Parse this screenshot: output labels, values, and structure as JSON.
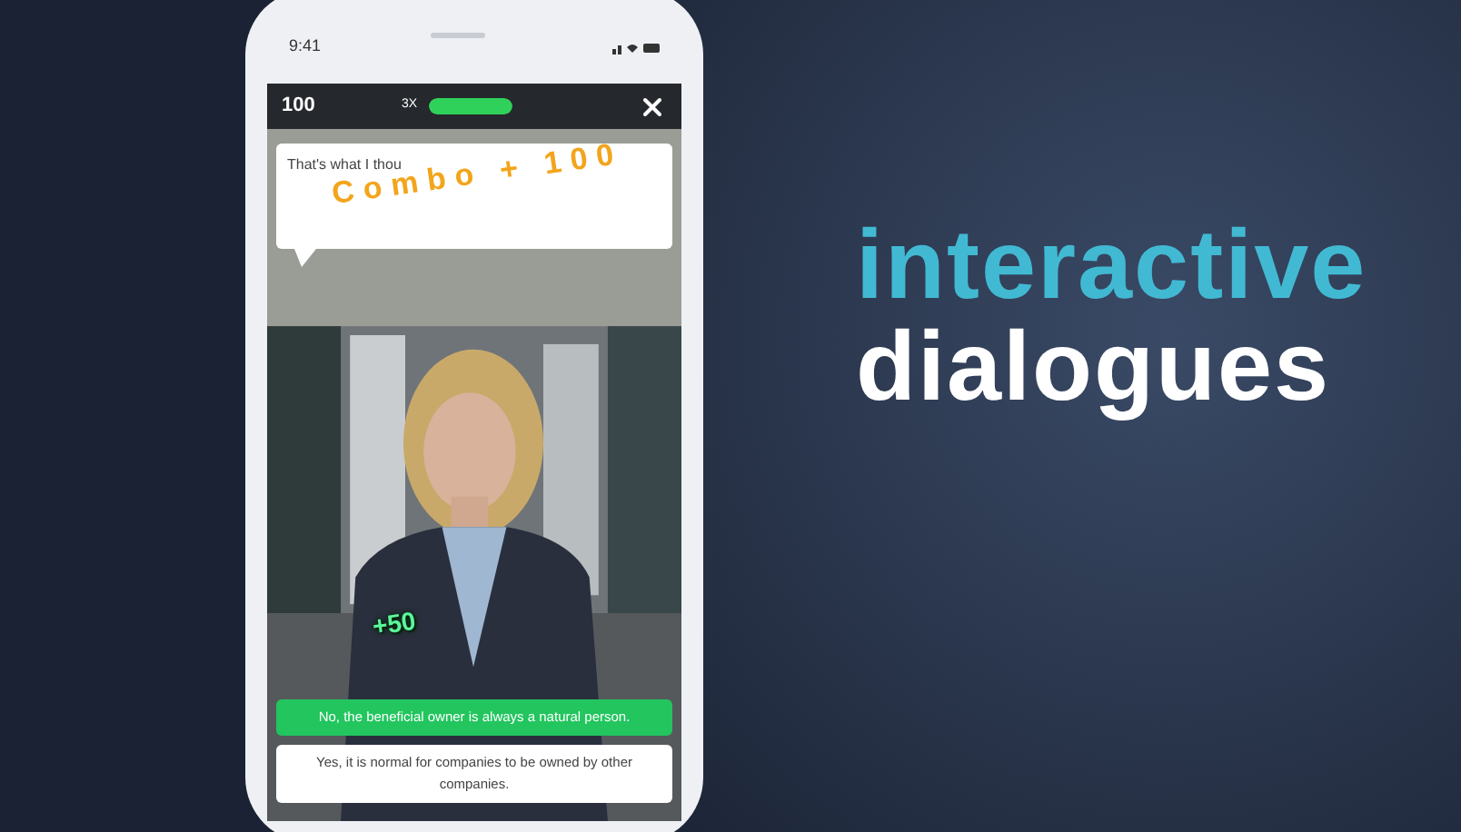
{
  "status_bar": {
    "time": "9:41"
  },
  "game_header": {
    "score": "100",
    "multiplier": "3X",
    "combo_meter": {
      "level": 1
    }
  },
  "speech_bubble": {
    "text": "That's what I thou"
  },
  "combo_popup": "Combo + 100",
  "points_popup": "+50",
  "answers": [
    {
      "text": "No, the beneficial owner is always a natural person.",
      "selected": true
    },
    {
      "text": "Yes, it is normal for companies to be owned by other companies.",
      "selected": false
    }
  ],
  "headline": [
    {
      "text": "interactive",
      "color": "#42b9d3"
    },
    {
      "text": "dialogues",
      "color": "#ffffff"
    }
  ]
}
